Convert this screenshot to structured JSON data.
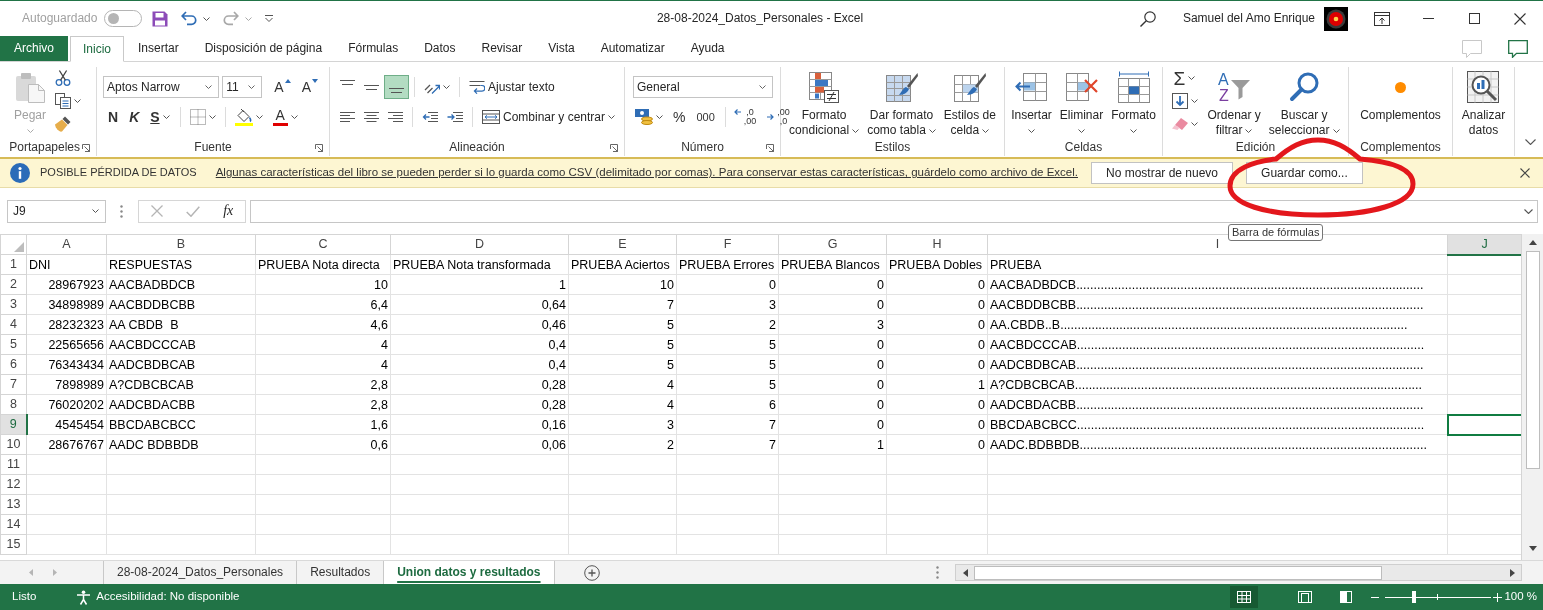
{
  "title_bar": {
    "autosave": {
      "label": "Autoguardado",
      "on": false
    },
    "quick_access": [
      {
        "kind": "save",
        "disabled": false
      },
      {
        "kind": "undo",
        "disabled": false
      },
      {
        "kind": "redo",
        "disabled": true
      },
      {
        "kind": "customize",
        "disabled": false
      }
    ],
    "title": "28-08-2024_Datos_Personales - Excel",
    "user": "Samuel del Amo Enrique"
  },
  "ribbon_tabs": [
    {
      "label": "Archivo",
      "kind": "file",
      "selected": false
    },
    {
      "label": "Inicio",
      "kind": "tab",
      "selected": true
    },
    {
      "label": "Insertar",
      "kind": "tab",
      "selected": false
    },
    {
      "label": "Disposición de página",
      "kind": "tab",
      "selected": false
    },
    {
      "label": "Fórmulas",
      "kind": "tab",
      "selected": false
    },
    {
      "label": "Datos",
      "kind": "tab",
      "selected": false
    },
    {
      "label": "Revisar",
      "kind": "tab",
      "selected": false
    },
    {
      "label": "Vista",
      "kind": "tab",
      "selected": false
    },
    {
      "label": "Automatizar",
      "kind": "tab",
      "selected": false
    },
    {
      "label": "Ayuda",
      "kind": "tab",
      "selected": false
    }
  ],
  "ribbon": {
    "groups": [
      {
        "label": "Portapapeles",
        "launcher": true,
        "kind": "columns",
        "items": [
          [
            {
              "kind": "large",
              "lines": [
                "Pegar"
              ],
              "caret": true,
              "disabled": true
            }
          ],
          [
            {
              "kind": "small",
              "disabled": false
            },
            {
              "kind": "small",
              "caret": true,
              "disabled": false
            },
            {
              "kind": "small",
              "disabled": false
            }
          ]
        ]
      },
      {
        "label": "Fuente",
        "launcher": true,
        "kind": "rows",
        "items": [
          [
            {
              "kind": "combo",
              "value": "Aptos Narrow"
            },
            {
              "kind": "combo",
              "value": "11"
            },
            {
              "kind": "glyph",
              "text": "A"
            },
            {
              "kind": "glyph",
              "text": "A"
            }
          ],
          [
            {
              "kind": "glyph",
              "text": "N"
            },
            {
              "kind": "glyph",
              "text": "K"
            },
            {
              "kind": "glyph",
              "text": "S",
              "caret": true
            },
            {
              "kind": "small",
              "caret": true
            },
            {
              "kind": "small",
              "caret": true
            },
            {
              "kind": "glyph",
              "text": "A",
              "caret": true
            }
          ]
        ]
      },
      {
        "label": "Alineación",
        "launcher": true,
        "kind": "rows",
        "items": [
          [
            {
              "kind": "small",
              "selected": false
            },
            {
              "kind": "small",
              "selected": false
            },
            {
              "kind": "small",
              "selected": true
            },
            {
              "kind": "small",
              "caret": true,
              "selected": false
            },
            {
              "kind": "small",
              "label": "Ajustar texto",
              "selected": false
            }
          ],
          [
            {
              "kind": "small",
              "selected": false
            },
            {
              "kind": "small",
              "selected": false
            },
            {
              "kind": "small",
              "selected": false
            },
            {
              "kind": "small",
              "selected": false
            },
            {
              "kind": "small",
              "selected": false
            },
            {
              "kind": "small",
              "label": "Combinar y centrar",
              "caret": true,
              "selected": false
            }
          ]
        ]
      },
      {
        "label": "Número",
        "launcher": true,
        "kind": "rows",
        "items": [
          [
            {
              "kind": "combo",
              "value": "General"
            }
          ],
          [
            {
              "kind": "small",
              "caret": true
            },
            {
              "kind": "glyph",
              "text": "%"
            },
            {
              "kind": "glyph",
              "text": "000"
            },
            {
              "kind": "glyph",
              "lines": [
                ",0",
                ",00"
              ]
            },
            {
              "kind": "glyph",
              "lines": [
                ",00",
                ",0"
              ]
            }
          ]
        ]
      },
      {
        "label": "Estilos",
        "kind": "columns",
        "items": [
          [
            {
              "kind": "large",
              "lines": [
                "Formato",
                "condicional"
              ],
              "caret": true
            }
          ],
          [
            {
              "kind": "large",
              "lines": [
                "Dar formato",
                "como tabla"
              ],
              "caret": true
            }
          ],
          [
            {
              "kind": "large",
              "lines": [
                "Estilos de",
                "celda"
              ],
              "caret": true
            }
          ]
        ]
      },
      {
        "label": "Celdas",
        "kind": "columns",
        "items": [
          [
            {
              "kind": "large",
              "lines": [
                "Insertar"
              ],
              "caret": true
            }
          ],
          [
            {
              "kind": "large",
              "lines": [
                "Eliminar"
              ],
              "caret": true
            }
          ],
          [
            {
              "kind": "large",
              "lines": [
                "Formato"
              ],
              "caret": true
            }
          ]
        ]
      },
      {
        "label": "Edición",
        "kind": "columns",
        "items": [
          [
            {
              "kind": "glyph",
              "text": "Σ",
              "caret": true
            },
            {
              "kind": "small",
              "caret": true
            },
            {
              "kind": "small",
              "caret": true
            }
          ],
          [
            {
              "kind": "large",
              "lines": [
                "Ordenar y",
                "filtrar"
              ],
              "caret": true,
              "icon_text": [
                "A",
                "Z"
              ]
            }
          ],
          [
            {
              "kind": "large",
              "lines": [
                "Buscar y",
                "seleccionar"
              ],
              "caret": true
            }
          ]
        ]
      },
      {
        "label": "Complementos",
        "kind": "columns",
        "items": [
          [
            {
              "kind": "large",
              "lines": [
                "Complementos"
              ]
            }
          ]
        ]
      },
      {
        "kind": "columns",
        "items": [
          [
            {
              "kind": "large",
              "lines": [
                "Analizar",
                "datos"
              ]
            }
          ]
        ]
      }
    ]
  },
  "message_bar": {
    "title": "POSIBLE PÉRDIDA DE DATOS",
    "message": "Algunas características del libro se pueden perder si lo guarda como CSV (delimitado por comas). Para conservar estas características, guárdelo como archivo de Excel.",
    "buttons": [
      "No mostrar de nuevo",
      "Guardar como..."
    ]
  },
  "formula_bar": {
    "name_box": "J9",
    "function_label": "fx",
    "tooltip": "Barra de fórmulas"
  },
  "sheet": {
    "columns": [
      {
        "label": "A",
        "selected": false
      },
      {
        "label": "B",
        "selected": false
      },
      {
        "label": "C",
        "selected": false
      },
      {
        "label": "D",
        "selected": false
      },
      {
        "label": "E",
        "selected": false
      },
      {
        "label": "F",
        "selected": false
      },
      {
        "label": "G",
        "selected": false
      },
      {
        "label": "H",
        "selected": false
      },
      {
        "label": "I",
        "selected": false
      },
      {
        "label": "J",
        "selected": true
      }
    ],
    "rows": [
      {
        "header": "1",
        "selected": false,
        "cells": [
          {
            "text": "DNI",
            "kind": "text"
          },
          {
            "text": "RESPUESTAS",
            "kind": "text"
          },
          {
            "text": "PRUEBA Nota directa",
            "kind": "text"
          },
          {
            "text": "PRUEBA Nota transformada",
            "kind": "text"
          },
          {
            "text": "PRUEBA Aciertos",
            "kind": "text"
          },
          {
            "text": "PRUEBA Errores",
            "kind": "text"
          },
          {
            "text": "PRUEBA Blancos",
            "kind": "text"
          },
          {
            "text": "PRUEBA Dobles",
            "kind": "text"
          },
          {
            "text": "PRUEBA",
            "kind": "text"
          }
        ]
      },
      {
        "header": "2",
        "selected": false,
        "cells": [
          {
            "text": "28967923",
            "kind": "number"
          },
          {
            "text": "AACBADBDCB",
            "kind": "text"
          },
          {
            "text": "10",
            "kind": "number"
          },
          {
            "text": "1",
            "kind": "number"
          },
          {
            "text": "10",
            "kind": "number"
          },
          {
            "text": "0",
            "kind": "number"
          },
          {
            "text": "0",
            "kind": "number"
          },
          {
            "text": "0",
            "kind": "number"
          },
          {
            "text": "AACBADBDCB....................................................................................................",
            "kind": "text"
          }
        ]
      },
      {
        "header": "3",
        "selected": false,
        "cells": [
          {
            "text": "34898989",
            "kind": "number"
          },
          {
            "text": "AACBDDBCBB",
            "kind": "text"
          },
          {
            "text": "6,4",
            "kind": "number"
          },
          {
            "text": "0,64",
            "kind": "number"
          },
          {
            "text": "7",
            "kind": "number"
          },
          {
            "text": "3",
            "kind": "number"
          },
          {
            "text": "0",
            "kind": "number"
          },
          {
            "text": "0",
            "kind": "number"
          },
          {
            "text": "AACBDDBCBB....................................................................................................",
            "kind": "text"
          }
        ]
      },
      {
        "header": "4",
        "selected": false,
        "cells": [
          {
            "text": "28232323",
            "kind": "number"
          },
          {
            "text": "AA CBDB  B",
            "kind": "text"
          },
          {
            "text": "4,6",
            "kind": "number"
          },
          {
            "text": "0,46",
            "kind": "number"
          },
          {
            "text": "5",
            "kind": "number"
          },
          {
            "text": "2",
            "kind": "number"
          },
          {
            "text": "3",
            "kind": "number"
          },
          {
            "text": "0",
            "kind": "number"
          },
          {
            "text": "AA.CBDB..B....................................................................................................",
            "kind": "text"
          }
        ]
      },
      {
        "header": "5",
        "selected": false,
        "cells": [
          {
            "text": "22565656",
            "kind": "number"
          },
          {
            "text": "AACBDCCCAB",
            "kind": "text"
          },
          {
            "text": "4",
            "kind": "number"
          },
          {
            "text": "0,4",
            "kind": "number"
          },
          {
            "text": "5",
            "kind": "number"
          },
          {
            "text": "5",
            "kind": "number"
          },
          {
            "text": "0",
            "kind": "number"
          },
          {
            "text": "0",
            "kind": "number"
          },
          {
            "text": "AACBDCCCAB....................................................................................................",
            "kind": "text"
          }
        ]
      },
      {
        "header": "6",
        "selected": false,
        "cells": [
          {
            "text": "76343434",
            "kind": "number"
          },
          {
            "text": "AADCBDBCAB",
            "kind": "text"
          },
          {
            "text": "4",
            "kind": "number"
          },
          {
            "text": "0,4",
            "kind": "number"
          },
          {
            "text": "5",
            "kind": "number"
          },
          {
            "text": "5",
            "kind": "number"
          },
          {
            "text": "0",
            "kind": "number"
          },
          {
            "text": "0",
            "kind": "number"
          },
          {
            "text": "AADCBDBCAB....................................................................................................",
            "kind": "text"
          }
        ]
      },
      {
        "header": "7",
        "selected": false,
        "cells": [
          {
            "text": "7898989",
            "kind": "number"
          },
          {
            "text": "A?CDBCBCAB",
            "kind": "text"
          },
          {
            "text": "2,8",
            "kind": "number"
          },
          {
            "text": "0,28",
            "kind": "number"
          },
          {
            "text": "4",
            "kind": "number"
          },
          {
            "text": "5",
            "kind": "number"
          },
          {
            "text": "0",
            "kind": "number"
          },
          {
            "text": "1",
            "kind": "number"
          },
          {
            "text": "A?CDBCBCAB....................................................................................................",
            "kind": "text"
          }
        ]
      },
      {
        "header": "8",
        "selected": false,
        "cells": [
          {
            "text": "76020202",
            "kind": "number"
          },
          {
            "text": "AADCBDACBB",
            "kind": "text"
          },
          {
            "text": "2,8",
            "kind": "number"
          },
          {
            "text": "0,28",
            "kind": "number"
          },
          {
            "text": "4",
            "kind": "number"
          },
          {
            "text": "6",
            "kind": "number"
          },
          {
            "text": "0",
            "kind": "number"
          },
          {
            "text": "0",
            "kind": "number"
          },
          {
            "text": "AADCBDACBB....................................................................................................",
            "kind": "text"
          }
        ]
      },
      {
        "header": "9",
        "selected": true,
        "cells": [
          {
            "text": "4545454",
            "kind": "number"
          },
          {
            "text": "BBCDABCBCC",
            "kind": "text"
          },
          {
            "text": "1,6",
            "kind": "number"
          },
          {
            "text": "0,16",
            "kind": "number"
          },
          {
            "text": "3",
            "kind": "number"
          },
          {
            "text": "7",
            "kind": "number"
          },
          {
            "text": "0",
            "kind": "number"
          },
          {
            "text": "0",
            "kind": "number"
          },
          {
            "text": "BBCDABCBCC....................................................................................................",
            "kind": "text"
          }
        ]
      },
      {
        "header": "10",
        "selected": false,
        "cells": [
          {
            "text": "28676767",
            "kind": "number"
          },
          {
            "text": "AADC BDBBDB",
            "kind": "text"
          },
          {
            "text": "0,6",
            "kind": "number"
          },
          {
            "text": "0,06",
            "kind": "number"
          },
          {
            "text": "2",
            "kind": "number"
          },
          {
            "text": "7",
            "kind": "number"
          },
          {
            "text": "1",
            "kind": "number"
          },
          {
            "text": "0",
            "kind": "number"
          },
          {
            "text": "AADC.BDBBDB....................................................................................................",
            "kind": "text"
          }
        ]
      },
      {
        "header": "11",
        "selected": false
      },
      {
        "header": "12",
        "selected": false
      },
      {
        "header": "13",
        "selected": false
      },
      {
        "header": "14",
        "selected": false
      },
      {
        "header": "15",
        "selected": false
      }
    ]
  },
  "sheet_tabs": [
    {
      "label": "28-08-2024_Datos_Personales",
      "selected": false
    },
    {
      "label": "Resultados",
      "selected": false
    },
    {
      "label": "Union datos y resultados",
      "selected": true
    }
  ],
  "status_bar": {
    "status": "Listo",
    "accessibility": "Accesibilidad: No disponible",
    "views": [
      {
        "kind": "normal",
        "selected": true
      },
      {
        "kind": "page_layout",
        "selected": false
      },
      {
        "kind": "page_break",
        "selected": false
      }
    ],
    "zoom": {
      "level": 0.27,
      "reading": "100 %"
    }
  },
  "annotation": {
    "kind": "ellipse"
  }
}
